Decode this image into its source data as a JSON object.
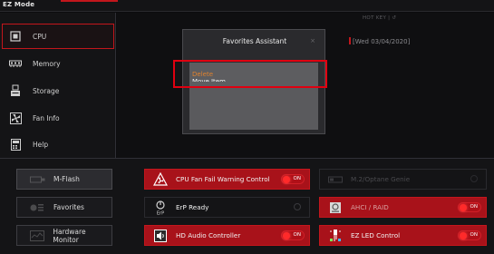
{
  "topbar": {
    "mode_label": "EZ Mode"
  },
  "sidebar": {
    "items": [
      {
        "label": "CPU",
        "icon": "cpu-icon",
        "active": true
      },
      {
        "label": "Memory",
        "icon": "memory-icon",
        "active": false
      },
      {
        "label": "Storage",
        "icon": "storage-icon",
        "active": false
      },
      {
        "label": "Fan Info",
        "icon": "fan-icon",
        "active": false
      },
      {
        "label": "Help",
        "icon": "help-icon",
        "active": false
      }
    ]
  },
  "header": {
    "hotkey": "HOT KEY  |  ↺",
    "date": "[Wed  03/04/2020]"
  },
  "dialog": {
    "title": "Favorites Assistant",
    "close_label": "×",
    "options": [
      "Delete",
      "Move Item"
    ]
  },
  "left_buttons": [
    {
      "label": "M-Flash",
      "icon": "flash-icon"
    },
    {
      "label": "Favorites",
      "icon": "favorites-icon"
    },
    {
      "label": "Hardware Monitor",
      "icon": "monitor-icon"
    }
  ],
  "features": {
    "cpu_fan": {
      "label": "CPU Fan Fail Warning Control",
      "state": "ON",
      "icon": "fan-warning-icon"
    },
    "erp": {
      "label": "ErP Ready",
      "icon": "erp-icon"
    },
    "hd_audio": {
      "label": "HD Audio Controller",
      "state": "ON",
      "icon": "audio-icon"
    },
    "m2_optane": {
      "label": "M.2/Optane Genie",
      "icon": "optane-icon"
    },
    "ahci": {
      "label": "AHCI / RAID",
      "state": "ON",
      "icon": "ahci-icon"
    },
    "ez_led": {
      "label": "EZ LED Control",
      "state": "ON",
      "icon": "led-icon"
    }
  },
  "colors": {
    "accent": "#c3161c",
    "highlight_box": "#e00010",
    "option_orange": "#e0802a"
  }
}
